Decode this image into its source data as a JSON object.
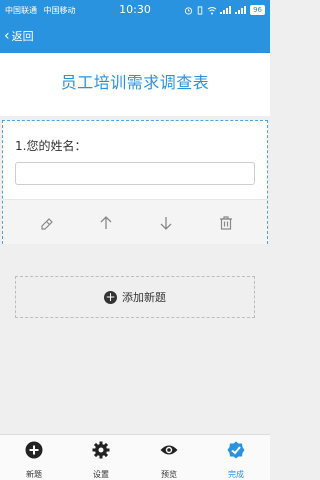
{
  "status_bar": {
    "carrier_1": "中国联通",
    "carrier_2": "中国移动",
    "time": "10:30",
    "battery": "96"
  },
  "nav": {
    "back_label": "返回"
  },
  "form": {
    "title": "员工培训需求调查表",
    "question": {
      "label": "1.您的姓名：",
      "input_value": ""
    },
    "add_question_label": "添加新题"
  },
  "tabs": [
    {
      "label": "新题",
      "icon": "plus-circle-icon"
    },
    {
      "label": "设置",
      "icon": "gear-icon"
    },
    {
      "label": "预览",
      "icon": "eye-icon"
    },
    {
      "label": "完成",
      "icon": "check-badge-icon",
      "active": true
    }
  ],
  "colors": {
    "accent": "#2a93e0",
    "background": "#efefef"
  }
}
